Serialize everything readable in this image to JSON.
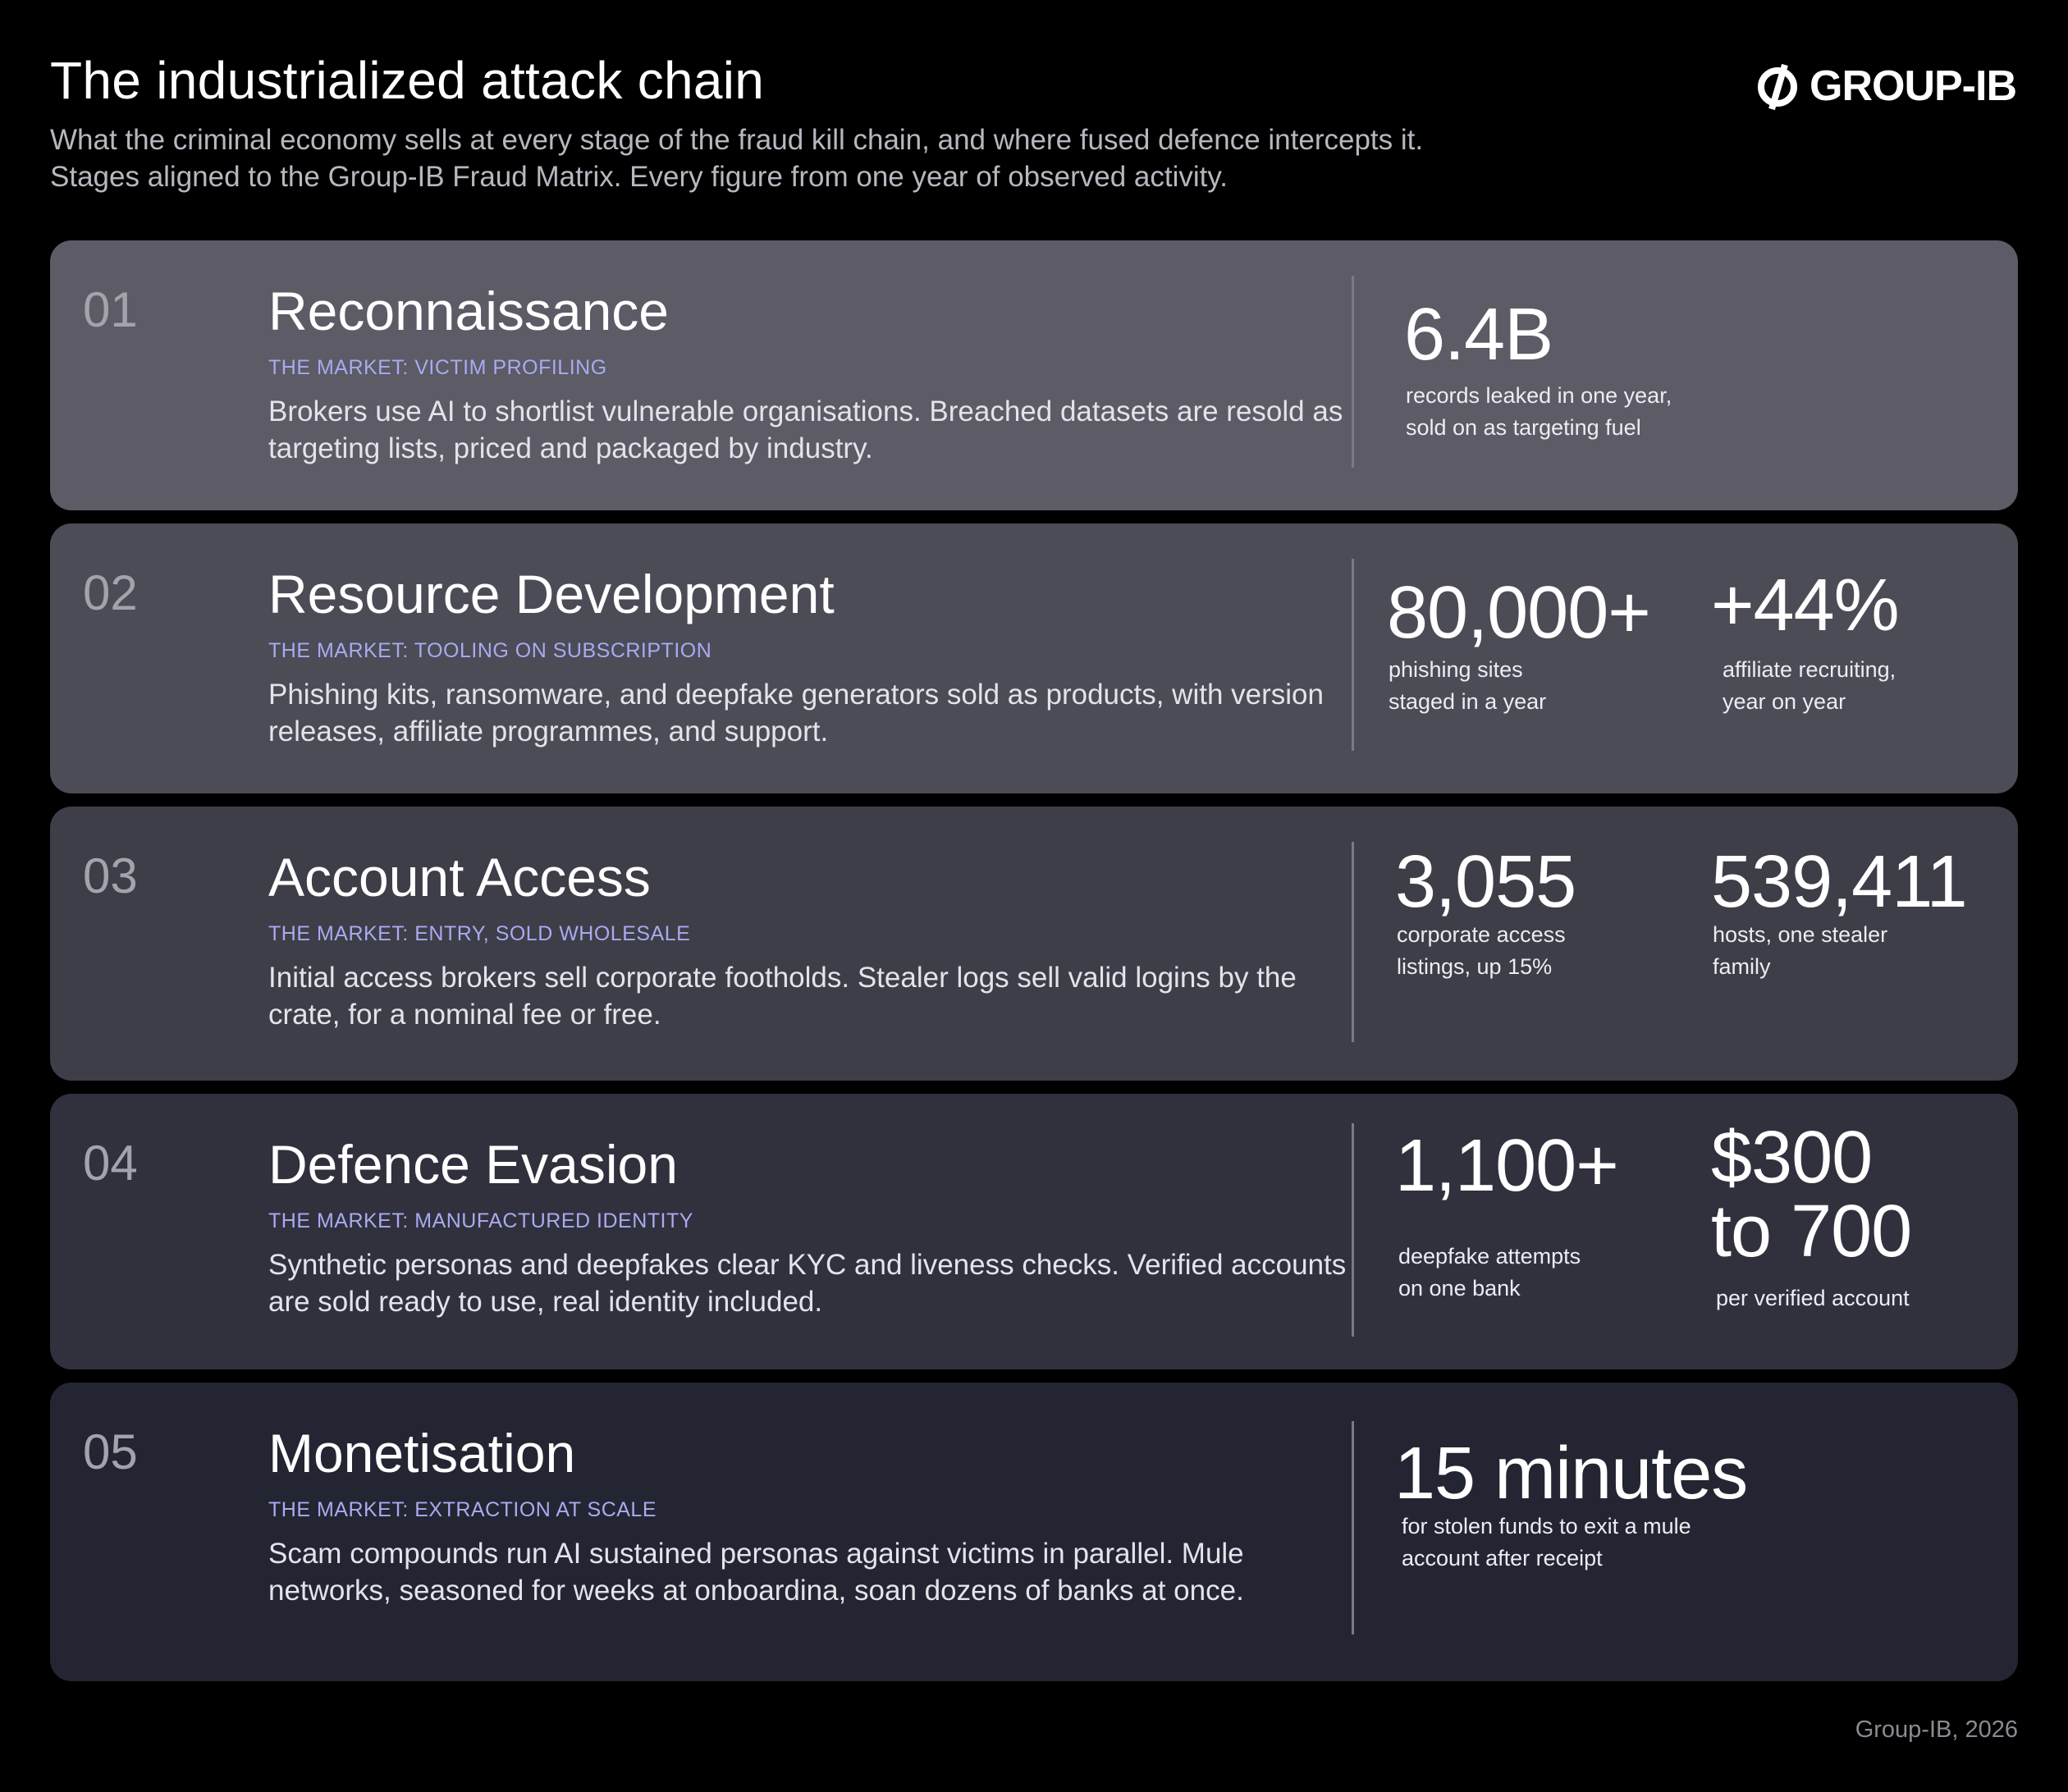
{
  "header": {
    "title": "The industrialized attack chain",
    "subtitle_line1": "What the criminal economy sells at every stage of the fraud kill chain, and where fused defence intercepts it.",
    "subtitle_line2": "Stages aligned to the Group-IB Fraud Matrix. Every figure from one year of observed activity.",
    "logo_text": "GROUP-IB"
  },
  "stages": [
    {
      "number": "01",
      "title": "Reconnaissance",
      "market": "THE MARKET: VICTIM PROFILING",
      "description": "Brokers use AI to shortlist vulnerable organisations. Breached datasets are resold as targeting lists, priced and packaged by industry.",
      "stats": [
        {
          "value": "6.4B",
          "label": "records leaked in one year,\nsold on as targeting fuel"
        }
      ]
    },
    {
      "number": "02",
      "title": "Resource Development",
      "market": "THE MARKET: TOOLING ON SUBSCRIPTION",
      "description": "Phishing kits, ransomware, and deepfake generators sold as products, with version releases, affiliate programmes, and support.",
      "stats": [
        {
          "value": "80,000+",
          "label": "phishing sites\nstaged in a year"
        },
        {
          "value": "+44%",
          "label": "affiliate recruiting,\nyear on year"
        }
      ]
    },
    {
      "number": "03",
      "title": "Account Access",
      "market": "THE MARKET: ENTRY, SOLD WHOLESALE",
      "description": "Initial access brokers sell corporate footholds. Stealer logs sell valid logins by the crate, for a nominal fee or free.",
      "stats": [
        {
          "value": "3,055",
          "label": "corporate access\nlistings, up 15%"
        },
        {
          "value": "539,411",
          "label": "hosts, one stealer\nfamily"
        }
      ]
    },
    {
      "number": "04",
      "title": "Defence Evasion",
      "market": "THE MARKET: MANUFACTURED IDENTITY",
      "description": "Synthetic personas and deepfakes clear KYC and liveness checks. Verified accounts are sold ready to use, real identity included.",
      "stats": [
        {
          "value": "1,100+",
          "label": "deepfake attempts\non one bank"
        },
        {
          "value_line1": "$300",
          "value_line2": "to 700",
          "label": "per verified account"
        }
      ]
    },
    {
      "number": "05",
      "title": "Monetisation",
      "market": "THE MARKET: EXTRACTION AT SCALE",
      "description": "Scam compounds run AI sustained personas against victims in parallel. Mule networks, seasoned for weeks at onboardina, soan dozens of banks at once.",
      "stats": [
        {
          "value": "15 minutes",
          "label": "for stolen funds to exit a mule\naccount after receipt"
        }
      ]
    }
  ],
  "colors": {
    "background": "#000000",
    "stage1": "#5c5b66",
    "stage2": "#4c4c57",
    "stage3": "#3e3e49",
    "stage4": "#30313d",
    "stage5": "#232532",
    "market_accent": "#a9aaf0"
  },
  "footer": {
    "credit": "Group-IB, 2026"
  }
}
